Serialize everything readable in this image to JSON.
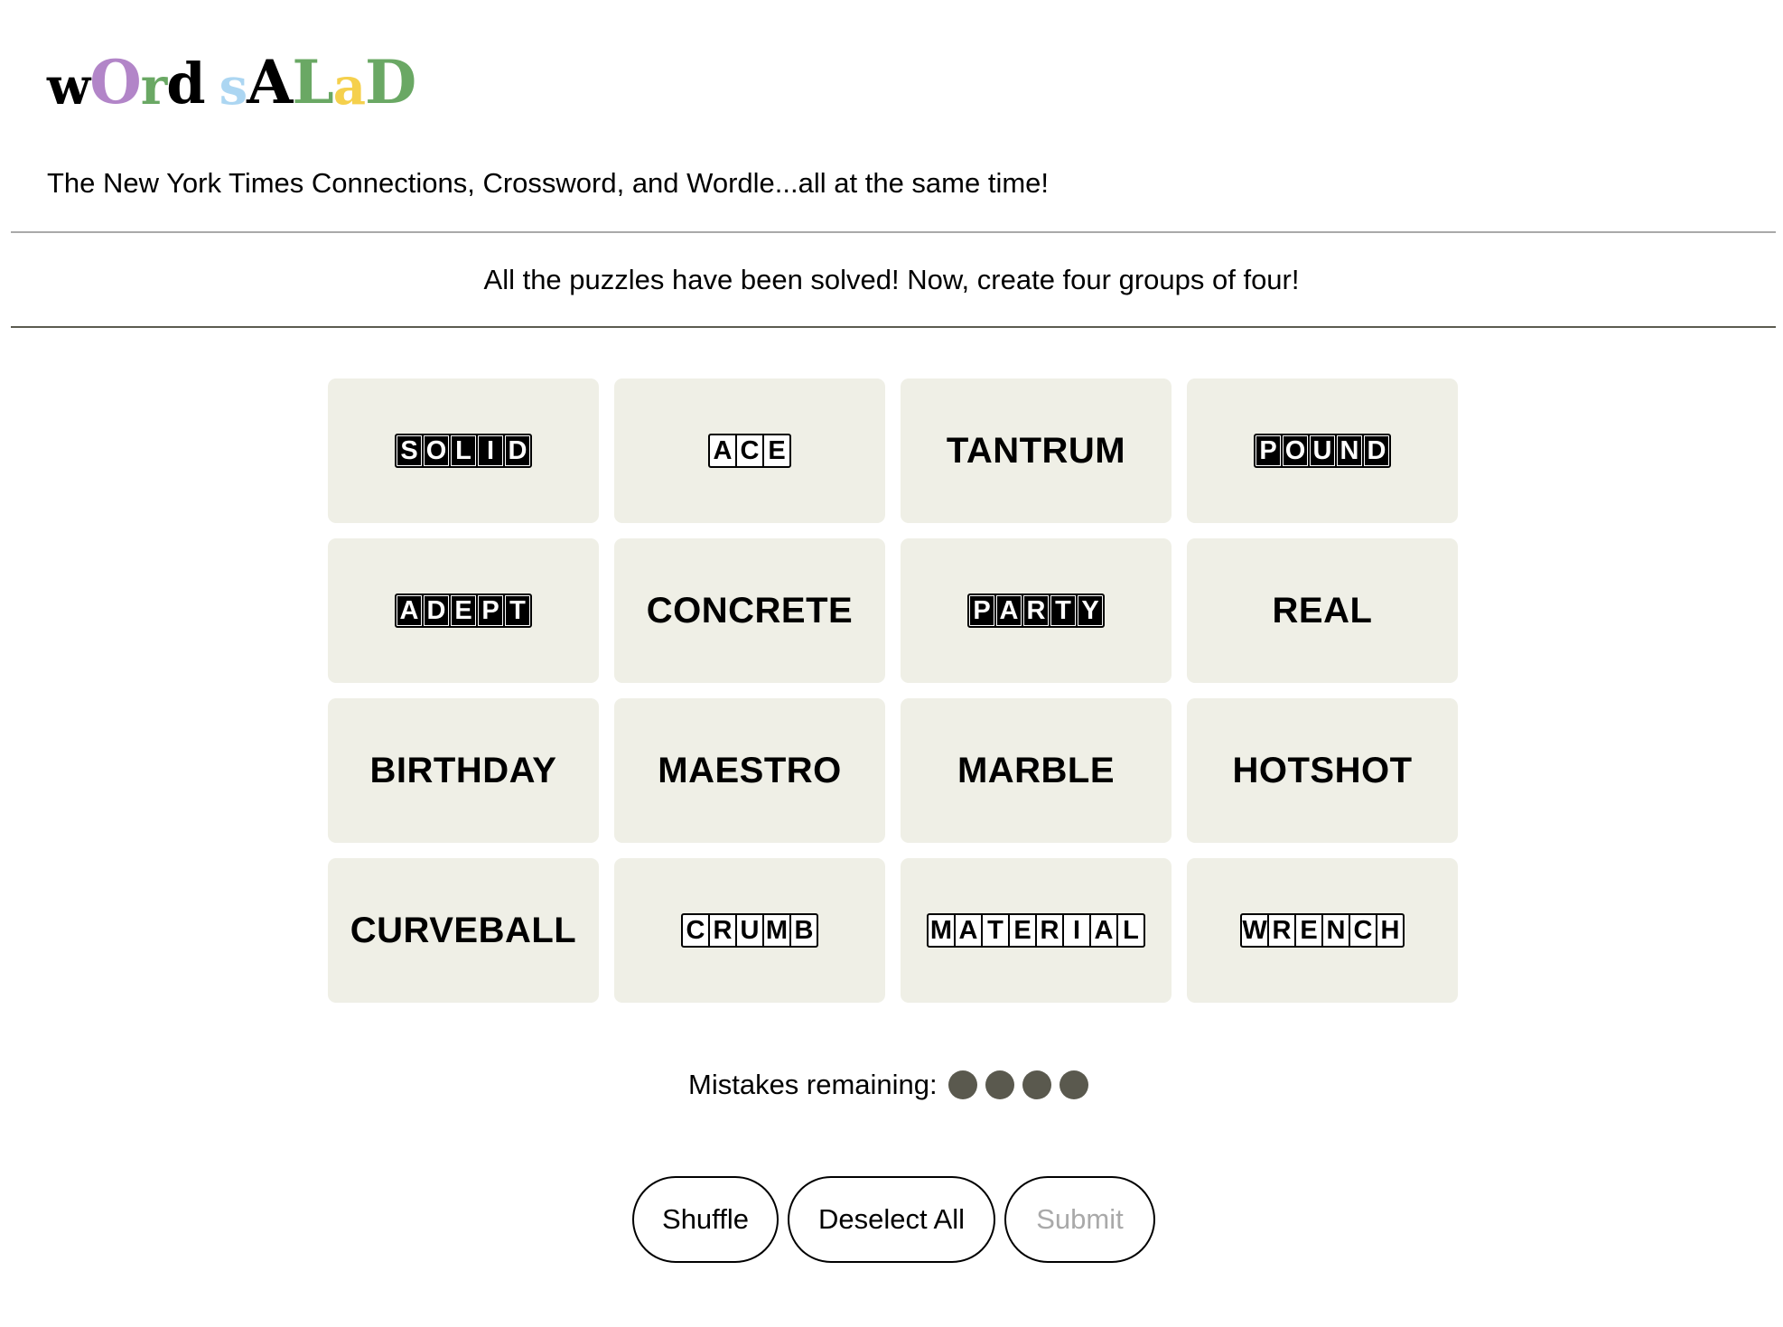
{
  "logo": {
    "letters": [
      {
        "ch": "w",
        "color": "#000000",
        "size": 56
      },
      {
        "ch": "O",
        "color": "#b285c8",
        "size": 66
      },
      {
        "ch": "r",
        "color": "#6aa864",
        "size": 56
      },
      {
        "ch": "d",
        "color": "#000000",
        "size": 62
      },
      {
        "ch": " ",
        "color": "#000000",
        "size": 56
      },
      {
        "ch": "s",
        "color": "#acd6f2",
        "size": 56
      },
      {
        "ch": "A",
        "color": "#000000",
        "size": 66
      },
      {
        "ch": "L",
        "color": "#6aa864",
        "size": 66
      },
      {
        "ch": "a",
        "color": "#f5d04c",
        "size": 56
      },
      {
        "ch": "D",
        "color": "#6aa864",
        "size": 66
      }
    ]
  },
  "tagline": "The New York Times Connections, Crossword, and Wordle...all at the same time!",
  "status": "All the puzzles have been solved! Now, create four groups of four!",
  "tiles": [
    {
      "word": "SOLID",
      "style": "filled"
    },
    {
      "word": "ACE",
      "style": "outline"
    },
    {
      "word": "TANTRUM",
      "style": "plain"
    },
    {
      "word": "POUND",
      "style": "filled"
    },
    {
      "word": "ADEPT",
      "style": "filled"
    },
    {
      "word": "CONCRETE",
      "style": "plain"
    },
    {
      "word": "PARTY",
      "style": "filled"
    },
    {
      "word": "REAL",
      "style": "plain"
    },
    {
      "word": "BIRTHDAY",
      "style": "plain"
    },
    {
      "word": "MAESTRO",
      "style": "plain"
    },
    {
      "word": "MARBLE",
      "style": "plain"
    },
    {
      "word": "HOTSHOT",
      "style": "plain"
    },
    {
      "word": "CURVEBALL",
      "style": "plain"
    },
    {
      "word": "CRUMB",
      "style": "outline"
    },
    {
      "word": "MATERIAL",
      "style": "outline"
    },
    {
      "word": "WRENCH",
      "style": "outline"
    }
  ],
  "mistakes": {
    "label": "Mistakes remaining:",
    "remaining": 4
  },
  "buttons": {
    "shuffle": "Shuffle",
    "deselect": "Deselect All",
    "submit": "Submit"
  },
  "colors": {
    "tile_bg": "#efefe6",
    "dot": "#5a594e",
    "disabled_text": "#a9a9a9"
  }
}
